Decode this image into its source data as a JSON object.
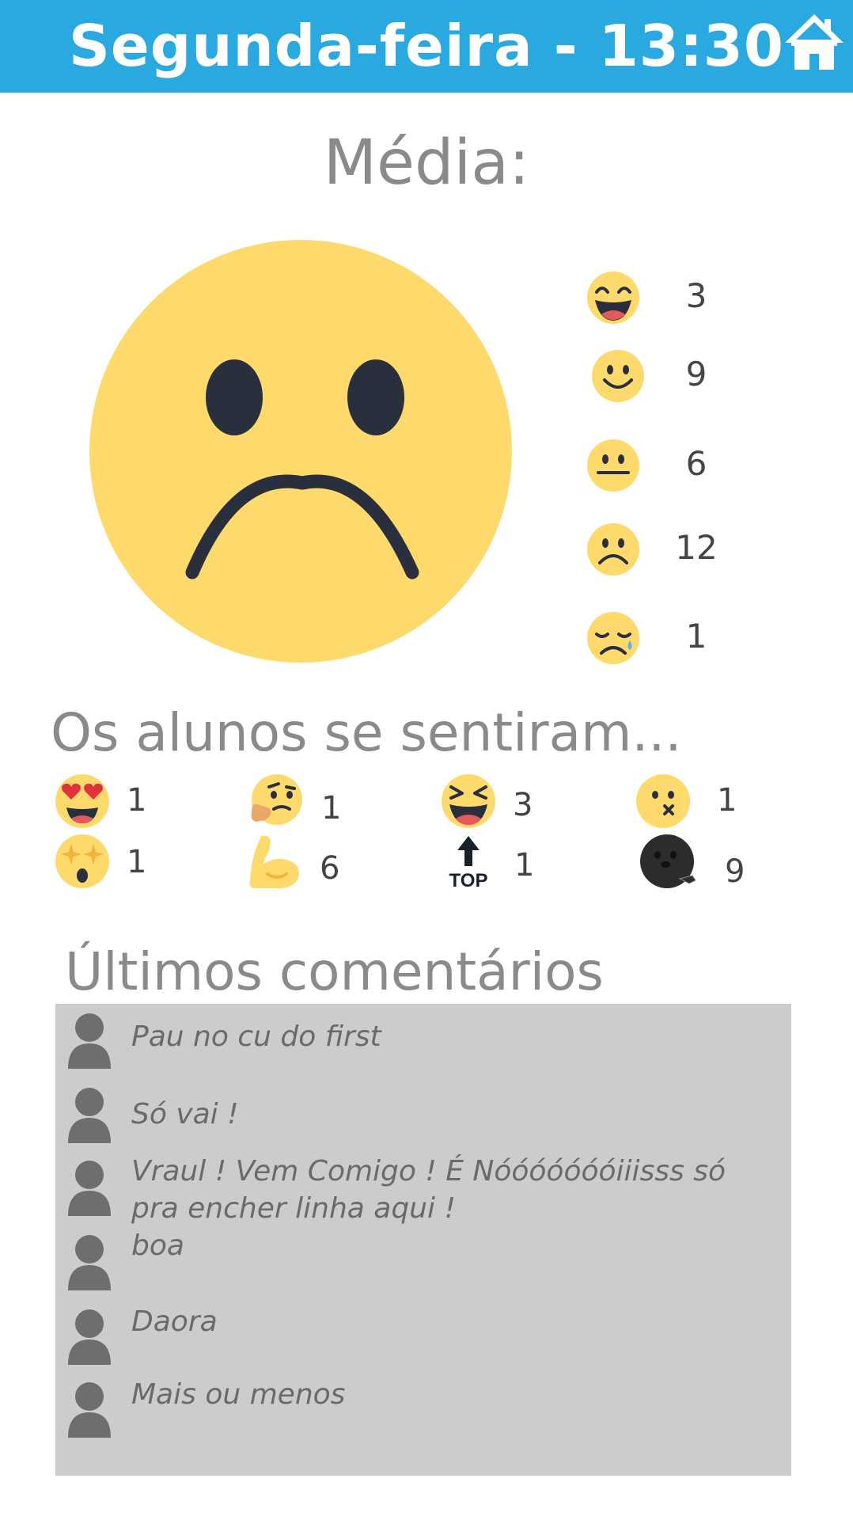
{
  "header": {
    "title": "Segunda-feira - 13:30",
    "background_color": "#2aa8e0",
    "home_icon": "home-icon"
  },
  "average": {
    "title": "Média:",
    "face": "sad-face",
    "face_color": "#fed96c"
  },
  "ratings": [
    {
      "icon": "laughing-face-icon",
      "count": "3"
    },
    {
      "icon": "smiling-face-icon",
      "count": "9"
    },
    {
      "icon": "neutral-face-icon",
      "count": "6"
    },
    {
      "icon": "frowning-face-icon",
      "count": "12"
    },
    {
      "icon": "crying-face-icon",
      "count": "1"
    }
  ],
  "feelings": {
    "title": "Os alunos se sentiram...",
    "items": [
      {
        "icon": "heart-eyes-icon",
        "count": "1"
      },
      {
        "icon": "thinking-face-icon",
        "count": "1"
      },
      {
        "icon": "squinting-laugh-icon",
        "count": "3"
      },
      {
        "icon": "zipped-face-icon",
        "count": "1"
      },
      {
        "icon": "star-struck-icon",
        "count": "1"
      },
      {
        "icon": "flexed-biceps-icon",
        "count": "6"
      },
      {
        "icon": "top-arrow-icon",
        "count": "1",
        "label": "TOP"
      },
      {
        "icon": "seal-icon",
        "count": "9"
      }
    ]
  },
  "comments": {
    "title": "Últimos comentários",
    "items": [
      {
        "text": "Pau no cu do first"
      },
      {
        "text": "Só vai !"
      },
      {
        "text": "Vraul ! Vem Comigo !  É Nóóóóóóóiiisss só pra encher linha aqui !"
      },
      {
        "text": "boa"
      },
      {
        "text": "Daora"
      },
      {
        "text": "Mais ou menos"
      }
    ]
  }
}
